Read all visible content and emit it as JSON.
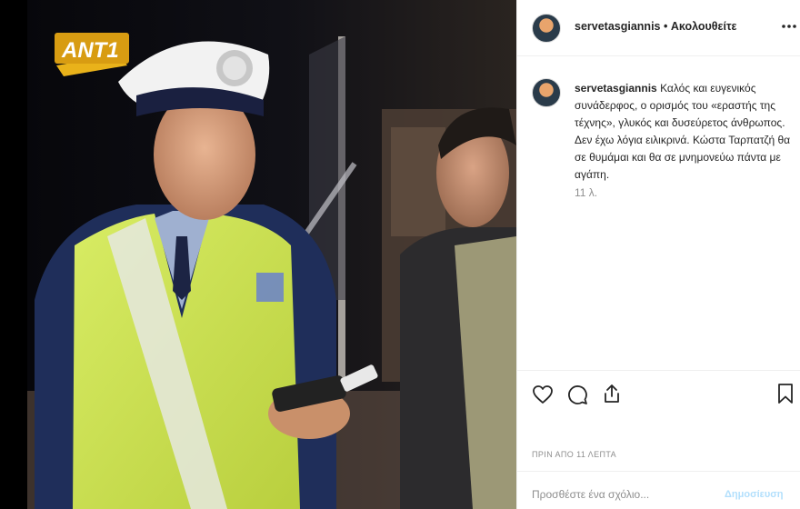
{
  "post": {
    "media": {
      "logo": "ANT1",
      "alt": "video frame"
    },
    "header": {
      "username": "servetasgiannis",
      "separator": "•",
      "follow": "Ακολουθείτε",
      "more_icon": "more-horizontal-icon"
    },
    "caption": {
      "username": "servetasgiannis",
      "text": "Καλός και ευγενικός συνάδερφος, ο ορισμός του «εραστής της τέχνης», γλυκός και δυσεύρετος άνθρωπος. Δεν έχω λόγια ειλικρινά. Κώστα Ταρπατζή θα σε θυμάμαι και θα σε μνημονεύω πάντα με αγάπη.",
      "age": "11 λ."
    },
    "actions": {
      "like_icon": "heart-icon",
      "comment_icon": "comment-icon",
      "share_icon": "share-icon",
      "save_icon": "bookmark-icon"
    },
    "timestamp": "ΠΡΙΝ ΑΠΟ 11 ΛΕΠΤΑ",
    "comment": {
      "placeholder": "Προσθέστε ένα σχόλιο...",
      "publish_label": "Δημοσίευση"
    }
  }
}
